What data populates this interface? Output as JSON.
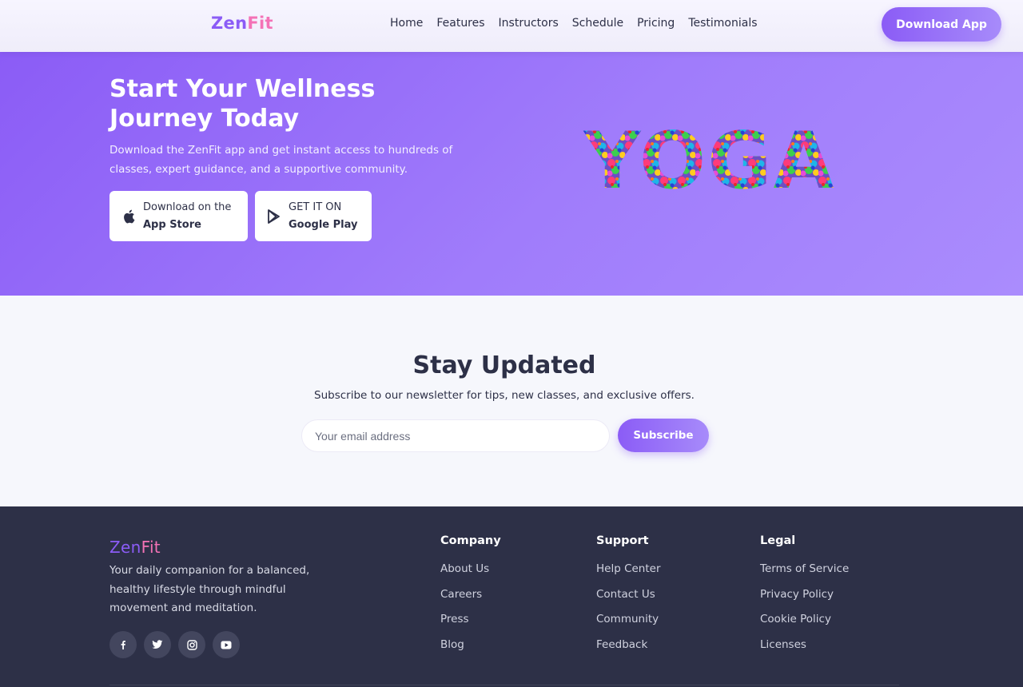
{
  "header": {
    "logo_a": "Zen",
    "logo_b": "Fit",
    "nav": [
      "Home",
      "Features",
      "Instructors",
      "Schedule",
      "Pricing",
      "Testimonials"
    ],
    "cta": "Download App"
  },
  "hero": {
    "title": "Start Your Wellness Journey Today",
    "description": "Download the ZenFit app and get instant access to hundreds of classes, expert guidance, and a supportive community.",
    "app_store": {
      "line1": "Download on the",
      "line2": "App Store",
      "icon": "apple-icon"
    },
    "google_play": {
      "line1": "GET IT ON",
      "line2": "Google Play",
      "icon": "play-store-icon"
    },
    "art_word": "YOGA"
  },
  "newsletter": {
    "title": "Stay Updated",
    "subtitle": "Subscribe to our newsletter for tips, new classes, and exclusive offers.",
    "placeholder": "Your email address",
    "button": "Subscribe"
  },
  "footer": {
    "logo_a": "Zen",
    "logo_b": "Fit",
    "description": "Your daily companion for a balanced, healthy lifestyle through mindful movement and meditation.",
    "socials": [
      "facebook-icon",
      "twitter-icon",
      "instagram-icon",
      "youtube-icon"
    ],
    "columns": [
      {
        "title": "Company",
        "links": [
          "About Us",
          "Careers",
          "Press",
          "Blog"
        ]
      },
      {
        "title": "Support",
        "links": [
          "Help Center",
          "Contact Us",
          "Community",
          "Feedback"
        ]
      },
      {
        "title": "Legal",
        "links": [
          "Terms of Service",
          "Privacy Policy",
          "Cookie Policy",
          "Licenses"
        ]
      }
    ]
  },
  "colors": {
    "accent": "#8b5cf6",
    "accent_light": "#a78bfa",
    "pink": "#f472b6",
    "dark": "#2d3047"
  }
}
